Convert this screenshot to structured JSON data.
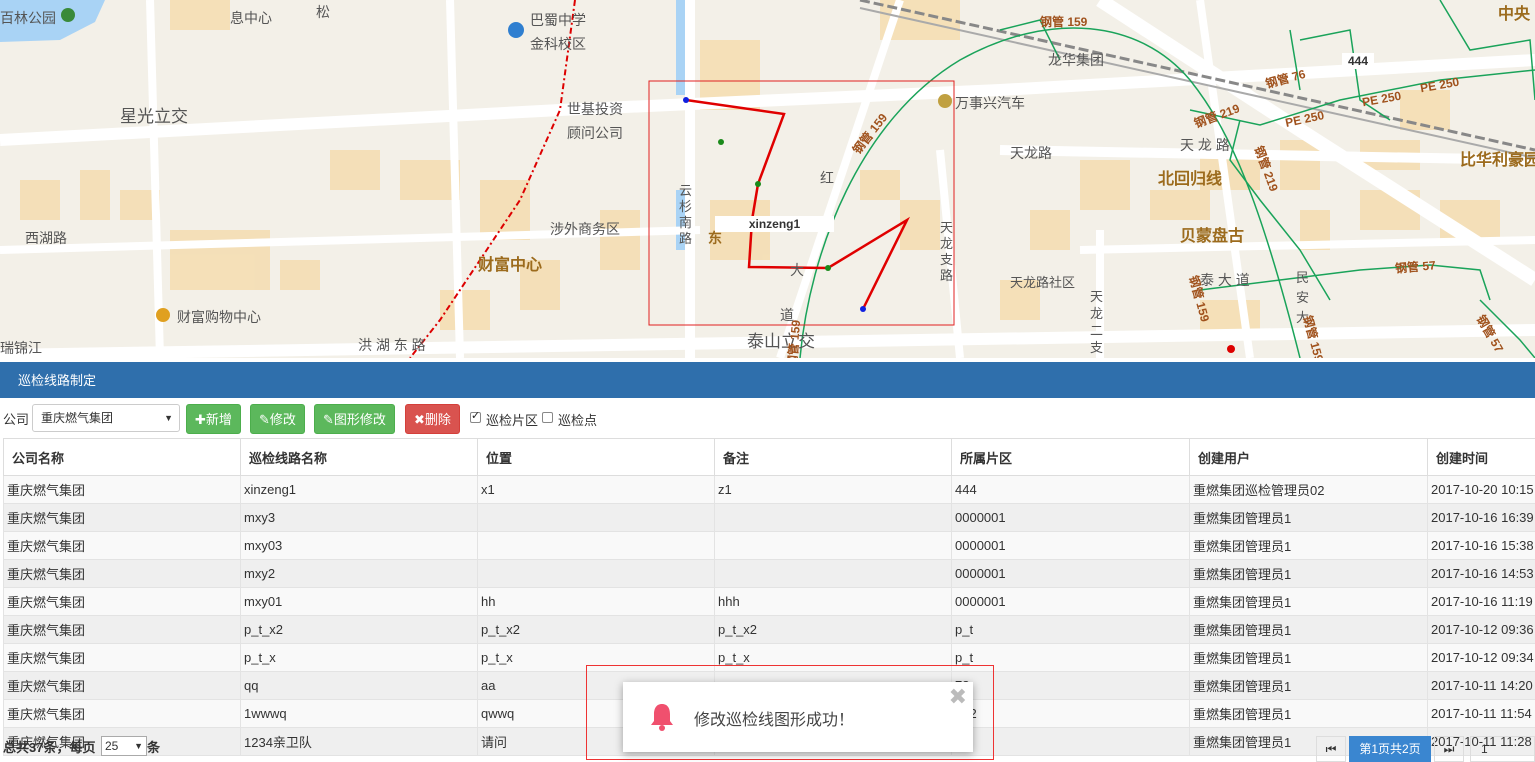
{
  "map": {
    "labels": {
      "baishi_park": "百林公园",
      "xinxi": "息中心",
      "song": "松",
      "bashu_school": "巴蜀中学",
      "jinke_campus": "金科校区",
      "xingguang": "星光立交",
      "shiji1": "世基投资",
      "shiji2": "顾问公司",
      "longhua": "龙华集团",
      "wanshixing": "万事兴汽车",
      "tianlong_road": "天龙路",
      "tianlong_e": "天 龙 路",
      "beihui": "北回归线",
      "bihua": "比华利豪园",
      "xihu_road": "西湖路",
      "shewai": "涉外商务区",
      "caifu_center": "财富中心",
      "yunshan": "云杉南路",
      "beimeng": "贝蒙盘古",
      "caifu_mall": "财富购物中心",
      "tianlong_zhi": "天龙支路",
      "tianlong_sq": "天龙路社区",
      "tianlong2": "天龙二支",
      "hongjin": "瑞锦江",
      "honghu": "洪 湖 东 路",
      "taishan": "泰山立交",
      "tai_da_dao": "泰 大 道",
      "minan": "民 安 大",
      "dong": "东",
      "hong": "红",
      "da": "大",
      "dao": "道",
      "zhongyang": "中央"
    },
    "pipes": {
      "p1": "钢管 159",
      "p2": "钢管 159",
      "p3": "钢管 76",
      "p4": "钢管 219",
      "p5": "PE 250",
      "p6": "PE 250",
      "p7": "PE 250",
      "p8": "钢管 219",
      "p9": "钢管 159",
      "p10": "钢管 159",
      "p11": "钢管 57",
      "p12": "钢管 159",
      "p13": "钢管 57"
    },
    "region_tag": "444",
    "route_tag": "xinzeng1"
  },
  "panel": {
    "title": "巡检线路制定"
  },
  "toolbar": {
    "company_label": "公司",
    "company_value": "重庆燃气集团",
    "add": "新增",
    "edit": "修改",
    "shape_edit": "图形修改",
    "delete": "删除",
    "chk_area": "巡检片区",
    "chk_point": "巡检点",
    "chk_area_checked": true,
    "chk_point_checked": false
  },
  "table": {
    "headers": [
      "公司名称",
      "巡检线路名称",
      "位置",
      "备注",
      "所属片区",
      "创建用户",
      "创建时间"
    ],
    "rows": [
      [
        "重庆燃气集团",
        "xinzeng1",
        "x1",
        "z1",
        "444",
        "重燃集团巡检管理员02",
        "2017-10-20 10:15"
      ],
      [
        "重庆燃气集团",
        "mxy3",
        "",
        "",
        "0000001",
        "重燃集团管理员1",
        "2017-10-16 16:39"
      ],
      [
        "重庆燃气集团",
        "mxy03",
        "",
        "",
        "0000001",
        "重燃集团管理员1",
        "2017-10-16 15:38"
      ],
      [
        "重庆燃气集团",
        "mxy2",
        "",
        "",
        "0000001",
        "重燃集团管理员1",
        "2017-10-16 14:53"
      ],
      [
        "重庆燃气集团",
        "mxy01",
        "hh",
        "hhh",
        "0000001",
        "重燃集团管理员1",
        "2017-10-16 11:19"
      ],
      [
        "重庆燃气集团",
        "p_t_x2",
        "p_t_x2",
        "p_t_x2",
        "p_t",
        "重燃集团管理员1",
        "2017-10-12 09:36"
      ],
      [
        "重庆燃气集团",
        "p_t_x",
        "p_t_x",
        "p_t_x",
        "p_t",
        "重燃集团管理员1",
        "2017-10-12 09:34"
      ],
      [
        "重庆燃气集团",
        "qq",
        "aa",
        "",
        "78",
        "重燃集团管理员1",
        "2017-10-11 14:20"
      ],
      [
        "重庆燃气集团",
        "1wwwq",
        "qwwq",
        "",
        "222",
        "重燃集团管理员1",
        "2017-10-11 11:54"
      ],
      [
        "重庆燃气集团",
        "1234亲卫队",
        "请问",
        "",
        "寺",
        "重燃集团管理员1",
        "2017-10-11 11:28"
      ]
    ]
  },
  "footer": {
    "total_prefix": "总共37条，每页",
    "page_size": "25",
    "suffix": "条",
    "page_info": "第1页共2页",
    "page_input": "1"
  },
  "toast": {
    "message": "修改巡检线图形成功！",
    "close": "✖"
  },
  "colors": {
    "header": "#2f6fac",
    "green": "#5cb85c",
    "red": "#d9534f",
    "route": "#e00000",
    "pipe": "#1aa35a"
  }
}
